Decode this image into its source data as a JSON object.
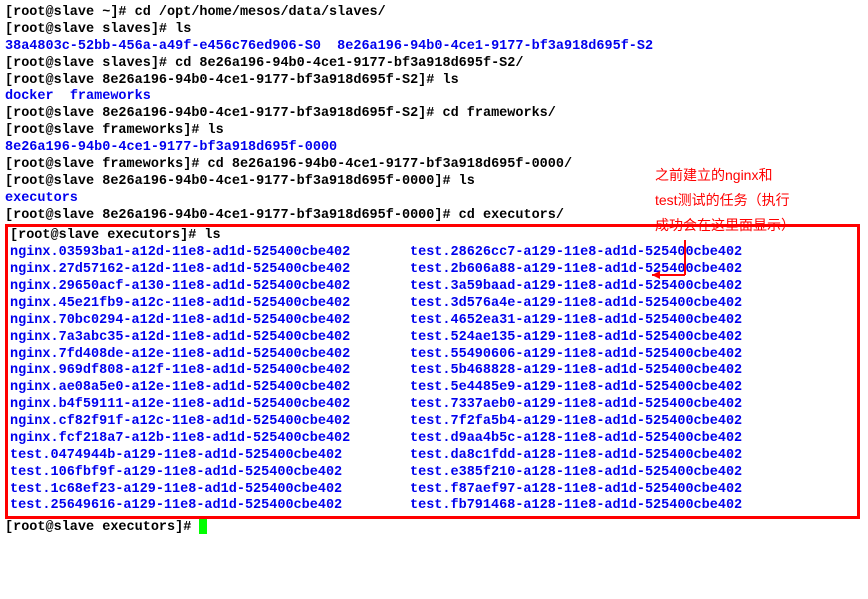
{
  "pre": {
    "l1": "[root@slave ~]# cd /opt/home/mesos/data/slaves/",
    "l2": "[root@slave slaves]# ls",
    "l3a": "38a4803c-52bb-456a-a49f-e456c76ed906-S0",
    "l3b": "8e26a196-94b0-4ce1-9177-bf3a918d695f-S2",
    "l4": "[root@slave slaves]# cd 8e26a196-94b0-4ce1-9177-bf3a918d695f-S2/",
    "l5": "[root@slave 8e26a196-94b0-4ce1-9177-bf3a918d695f-S2]# ls",
    "l6a": "docker",
    "l6b": "frameworks",
    "l7": "[root@slave 8e26a196-94b0-4ce1-9177-bf3a918d695f-S2]# cd frameworks/",
    "l8": "[root@slave frameworks]# ls",
    "l9": "8e26a196-94b0-4ce1-9177-bf3a918d695f-0000",
    "l10": "[root@slave frameworks]# cd 8e26a196-94b0-4ce1-9177-bf3a918d695f-0000/",
    "l11": "[root@slave 8e26a196-94b0-4ce1-9177-bf3a918d695f-0000]# ls",
    "l12": "executors",
    "l13": "[root@slave 8e26a196-94b0-4ce1-9177-bf3a918d695f-0000]# cd executors/"
  },
  "box": {
    "prompt": "[root@slave executors]# ls",
    "left": [
      "nginx.03593ba1-a12d-11e8-ad1d-525400cbe402",
      "nginx.27d57162-a12d-11e8-ad1d-525400cbe402",
      "nginx.29650acf-a130-11e8-ad1d-525400cbe402",
      "nginx.45e21fb9-a12c-11e8-ad1d-525400cbe402",
      "nginx.70bc0294-a12d-11e8-ad1d-525400cbe402",
      "nginx.7a3abc35-a12d-11e8-ad1d-525400cbe402",
      "nginx.7fd408de-a12e-11e8-ad1d-525400cbe402",
      "nginx.969df808-a12f-11e8-ad1d-525400cbe402",
      "nginx.ae08a5e0-a12e-11e8-ad1d-525400cbe402",
      "nginx.b4f59111-a12e-11e8-ad1d-525400cbe402",
      "nginx.cf82f91f-a12c-11e8-ad1d-525400cbe402",
      "nginx.fcf218a7-a12b-11e8-ad1d-525400cbe402",
      "test.0474944b-a129-11e8-ad1d-525400cbe402",
      "test.106fbf9f-a129-11e8-ad1d-525400cbe402",
      "test.1c68ef23-a129-11e8-ad1d-525400cbe402",
      "test.25649616-a129-11e8-ad1d-525400cbe402"
    ],
    "right": [
      "test.28626cc7-a129-11e8-ad1d-525400cbe402",
      "test.2b606a88-a129-11e8-ad1d-525400cbe402",
      "test.3a59baad-a129-11e8-ad1d-525400cbe402",
      "test.3d576a4e-a129-11e8-ad1d-525400cbe402",
      "test.4652ea31-a129-11e8-ad1d-525400cbe402",
      "test.524ae135-a129-11e8-ad1d-525400cbe402",
      "test.55490606-a129-11e8-ad1d-525400cbe402",
      "test.5b468828-a129-11e8-ad1d-525400cbe402",
      "test.5e4485e9-a129-11e8-ad1d-525400cbe402",
      "test.7337aeb0-a129-11e8-ad1d-525400cbe402",
      "test.7f2fa5b4-a129-11e8-ad1d-525400cbe402",
      "test.d9aa4b5c-a128-11e8-ad1d-525400cbe402",
      "test.da8c1fdd-a128-11e8-ad1d-525400cbe402",
      "test.e385f210-a128-11e8-ad1d-525400cbe402",
      "test.f87aef97-a128-11e8-ad1d-525400cbe402",
      "test.fb791468-a128-11e8-ad1d-525400cbe402"
    ]
  },
  "post": {
    "prompt": "[root@slave executors]# "
  },
  "annotation": {
    "l1": "之前建立的nginx和",
    "l2": "test测试的任务（执行",
    "l3": "成功会在这里面显示）"
  }
}
